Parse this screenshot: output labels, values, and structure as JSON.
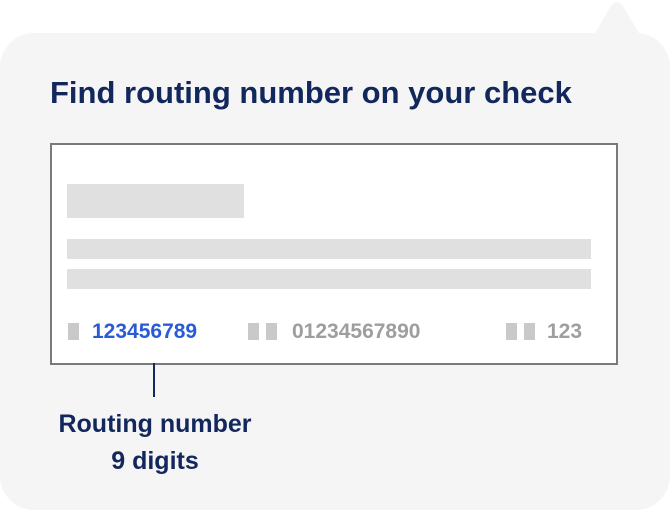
{
  "title": "Find routing number on your check",
  "check": {
    "routing_number": "123456789",
    "account_number": "01234567890",
    "check_number": "123"
  },
  "caption": {
    "line1": "Routing number",
    "line2": "9 digits"
  },
  "colors": {
    "bubble_background": "#f5f5f6",
    "title_text": "#12275c",
    "routing_highlight": "#2a5bd7",
    "muted_digits": "#9e9e9e",
    "placeholder_bar": "#e0e0e0",
    "check_border": "#7a7a7a"
  },
  "icons": {
    "pointer": "tooltip-pointer-icon"
  }
}
